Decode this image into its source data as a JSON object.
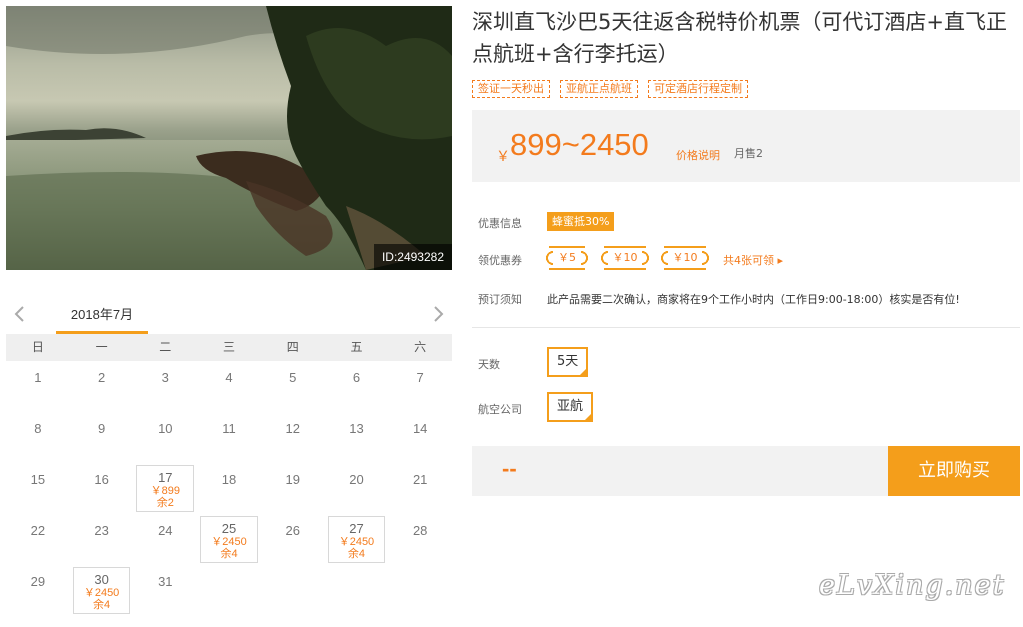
{
  "photo": {
    "id_label": "ID:2493282"
  },
  "calendar": {
    "month_label": "2018年7月",
    "weekdays": [
      "日",
      "一",
      "二",
      "三",
      "四",
      "五",
      "六"
    ],
    "weeks": [
      [
        {
          "d": "1"
        },
        {
          "d": "2"
        },
        {
          "d": "3"
        },
        {
          "d": "4"
        },
        {
          "d": "5"
        },
        {
          "d": "6"
        },
        {
          "d": "7"
        }
      ],
      [
        {
          "d": "8"
        },
        {
          "d": "9"
        },
        {
          "d": "10"
        },
        {
          "d": "11"
        },
        {
          "d": "12"
        },
        {
          "d": "13"
        },
        {
          "d": "14"
        }
      ],
      [
        {
          "d": "15"
        },
        {
          "d": "16"
        },
        {
          "d": "17",
          "price": "￥899",
          "remain": "余2"
        },
        {
          "d": "18"
        },
        {
          "d": "19"
        },
        {
          "d": "20"
        },
        {
          "d": "21"
        }
      ],
      [
        {
          "d": "22"
        },
        {
          "d": "23"
        },
        {
          "d": "24"
        },
        {
          "d": "25",
          "price": "￥2450",
          "remain": "余4"
        },
        {
          "d": "26"
        },
        {
          "d": "27",
          "price": "￥2450",
          "remain": "余4"
        },
        {
          "d": "28"
        }
      ],
      [
        {
          "d": "29"
        },
        {
          "d": "30",
          "price": "￥2450",
          "remain": "余4"
        },
        {
          "d": "31"
        },
        {
          "d": ""
        },
        {
          "d": ""
        },
        {
          "d": ""
        },
        {
          "d": ""
        }
      ]
    ]
  },
  "product": {
    "title": "深圳直飞沙巴5天往返含税特价机票（可代订酒店+直飞正点航班+含行李托运）",
    "tags": [
      "签证一天秒出",
      "亚航正点航班",
      "可定酒店行程定制"
    ],
    "price": {
      "currency": "￥",
      "range": "899~2450",
      "note": "价格说明",
      "sold": "月售2"
    },
    "promo": {
      "label": "优惠信息",
      "badge": "蜂蜜抵30%"
    },
    "coupons": {
      "label": "领优惠券",
      "items": [
        "￥5",
        "￥10",
        "￥10"
      ],
      "more": "共4张可领 ▸"
    },
    "booking": {
      "label": "预订须知",
      "text": "此产品需要二次确认，商家将在9个工作小时内（工作日9:00-18:00）核实是否有位!"
    },
    "days": {
      "label": "天数",
      "value": "5天"
    },
    "airline": {
      "label": "航空公司",
      "value": "亚航"
    },
    "total": "--",
    "buy_label": "立即购买"
  },
  "watermark": "eLvXing.net",
  "colors": {
    "accent": "#f49e1b",
    "price": "#f37b1d"
  }
}
